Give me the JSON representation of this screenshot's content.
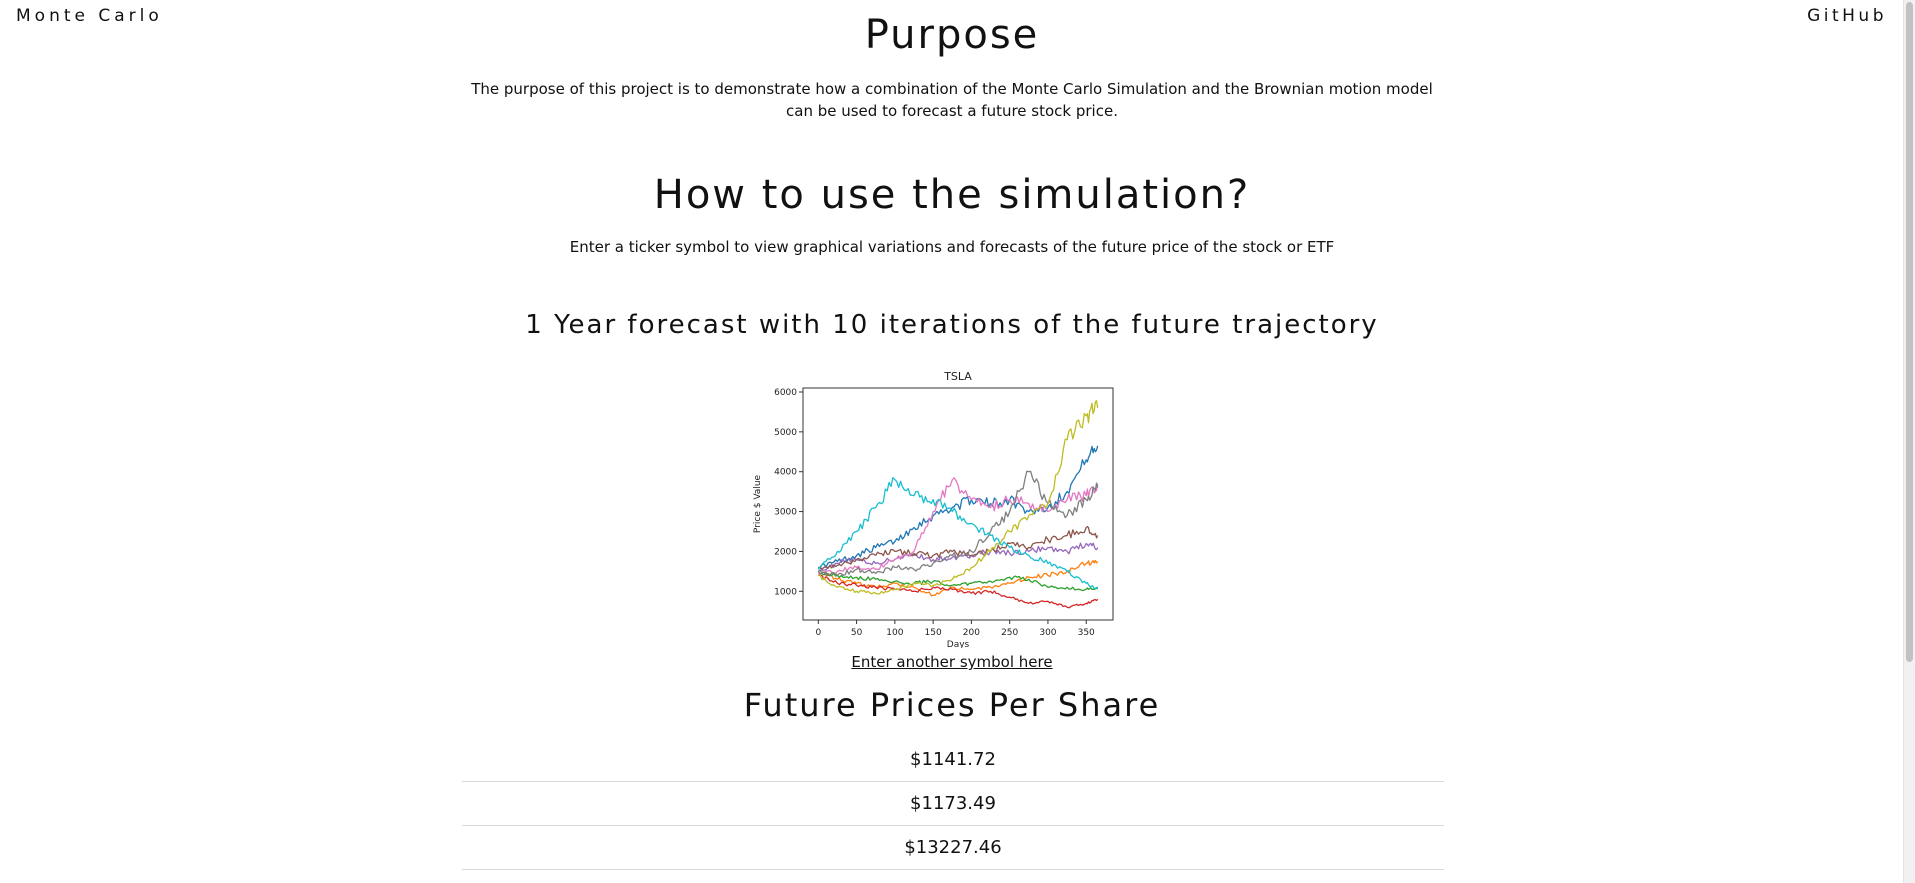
{
  "nav": {
    "brand": "Monte Carlo",
    "github": "GitHub"
  },
  "purpose": {
    "title": "Purpose",
    "text": "The purpose of this project is to demonstrate how a combination of the Monte Carlo Simulation and the Brownian motion model can be used to forecast a future stock price."
  },
  "howto": {
    "title": "How to use the simulation?",
    "text": "Enter a ticker symbol to view graphical variations and forecasts of the future price of the stock or ETF"
  },
  "forecast": {
    "title": "1 Year forecast with 10 iterations of the future trajectory"
  },
  "link": {
    "another": "Enter another symbol here"
  },
  "future": {
    "title": "Future Prices Per Share",
    "prices": [
      "$1141.72",
      "$1173.49",
      "$13227.46"
    ]
  },
  "chart_data": {
    "type": "line",
    "title": "TSLA",
    "xlabel": "Days",
    "ylabel": "Price $ Value",
    "xlim": [
      -20,
      385
    ],
    "ylim": [
      280,
      6100
    ],
    "xticks": [
      0,
      50,
      100,
      150,
      200,
      250,
      300,
      350
    ],
    "yticks": [
      1000,
      2000,
      3000,
      4000,
      5000,
      6000
    ],
    "x": [
      0,
      25,
      50,
      75,
      100,
      125,
      150,
      175,
      200,
      225,
      250,
      275,
      300,
      325,
      350,
      365
    ],
    "series": [
      {
        "color": "#1f77b4",
        "values": [
          1600,
          1750,
          1900,
          2100,
          2250,
          2600,
          2900,
          3100,
          3300,
          3200,
          3300,
          3000,
          3100,
          3500,
          4300,
          4650
        ]
      },
      {
        "color": "#ff7f0e",
        "values": [
          1500,
          1300,
          1200,
          1100,
          1200,
          1100,
          900,
          1100,
          1050,
          1100,
          1200,
          1350,
          1400,
          1500,
          1700,
          1750
        ]
      },
      {
        "color": "#2ca02c",
        "values": [
          1500,
          1400,
          1350,
          1300,
          1250,
          1200,
          1250,
          1150,
          1200,
          1250,
          1350,
          1300,
          1100,
          1100,
          1050,
          1100
        ]
      },
      {
        "color": "#d62728",
        "values": [
          1400,
          1200,
          1150,
          1100,
          1050,
          1000,
          1100,
          1050,
          950,
          1000,
          850,
          700,
          750,
          600,
          700,
          800
        ]
      },
      {
        "color": "#9467bd",
        "values": [
          1500,
          1700,
          1800,
          1700,
          1800,
          1900,
          1800,
          1850,
          1900,
          2000,
          1950,
          2000,
          2100,
          2000,
          2200,
          2100
        ]
      },
      {
        "color": "#8c564b",
        "values": [
          1600,
          1650,
          1800,
          1900,
          2000,
          1950,
          1900,
          2000,
          1900,
          2000,
          2200,
          2100,
          2300,
          2400,
          2600,
          2400
        ]
      },
      {
        "color": "#e377c2",
        "values": [
          1450,
          1500,
          1600,
          1550,
          1800,
          2000,
          3000,
          3800,
          3300,
          3100,
          3300,
          3200,
          3000,
          3300,
          3400,
          3700
        ]
      },
      {
        "color": "#7f7f7f",
        "values": [
          1500,
          1400,
          1550,
          1450,
          1600,
          1550,
          1700,
          1900,
          2000,
          2500,
          3000,
          4000,
          3200,
          2900,
          3300,
          3600
        ]
      },
      {
        "color": "#bcbd22",
        "values": [
          1400,
          1100,
          1000,
          950,
          1050,
          1200,
          1150,
          1300,
          1600,
          2000,
          2500,
          2900,
          3200,
          4800,
          5400,
          5600
        ]
      },
      {
        "color": "#17becf",
        "values": [
          1550,
          2000,
          2500,
          3100,
          3800,
          3400,
          3300,
          3000,
          2700,
          2400,
          2100,
          1900,
          1700,
          1500,
          1200,
          1050
        ]
      }
    ]
  }
}
